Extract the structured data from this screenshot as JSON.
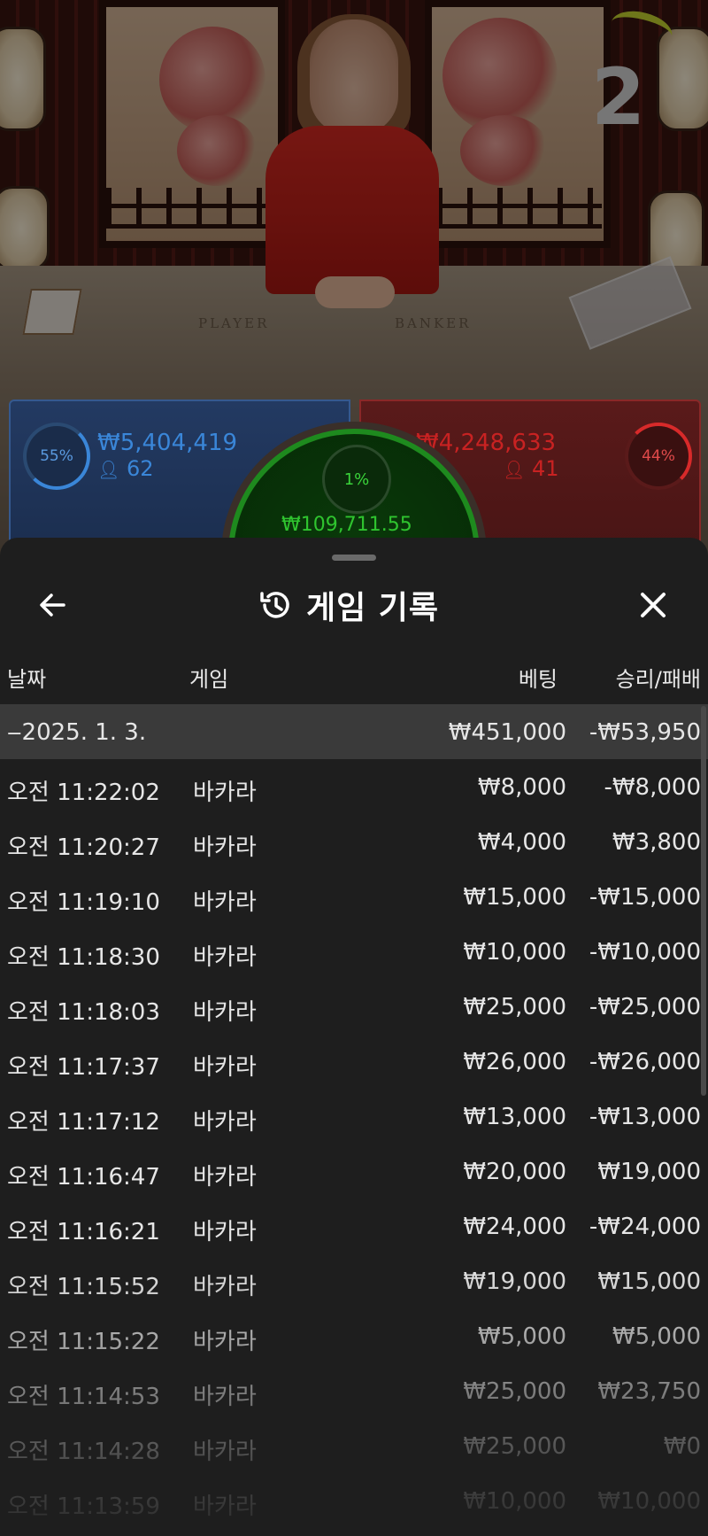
{
  "scene": {
    "round_number": "2",
    "table_player_label": "PLAYER",
    "table_banker_label": "BANKER"
  },
  "bets": {
    "player": {
      "percent": "55%",
      "amount": "₩5,404,419",
      "count": "62",
      "color": "#3a86d8"
    },
    "banker": {
      "percent": "44%",
      "amount": "₩4,248,633",
      "count": "41",
      "color": "#d82a2a"
    },
    "tie": {
      "percent": "1%",
      "amount": "₩109,711.55",
      "color": "#2fc42f"
    }
  },
  "sheet": {
    "title": "게임 기록",
    "history_icon": "history-icon",
    "back_icon": "arrow-left-icon",
    "close_icon": "close-icon",
    "columns": {
      "date": "날짜",
      "game": "게임",
      "bet": "베팅",
      "result": "승리/패배"
    },
    "day_row": {
      "date": "‒2025. 1. 3.",
      "bet": "₩451,000",
      "result": "-₩53,950"
    },
    "rows": [
      {
        "time": "오전 11:22:02",
        "game": "바카라",
        "bet": "₩8,000",
        "result": "-₩8,000"
      },
      {
        "time": "오전 11:20:27",
        "game": "바카라",
        "bet": "₩4,000",
        "result": "₩3,800"
      },
      {
        "time": "오전 11:19:10",
        "game": "바카라",
        "bet": "₩15,000",
        "result": "-₩15,000"
      },
      {
        "time": "오전 11:18:30",
        "game": "바카라",
        "bet": "₩10,000",
        "result": "-₩10,000"
      },
      {
        "time": "오전 11:18:03",
        "game": "바카라",
        "bet": "₩25,000",
        "result": "-₩25,000"
      },
      {
        "time": "오전 11:17:37",
        "game": "바카라",
        "bet": "₩26,000",
        "result": "-₩26,000"
      },
      {
        "time": "오전 11:17:12",
        "game": "바카라",
        "bet": "₩13,000",
        "result": "-₩13,000"
      },
      {
        "time": "오전 11:16:47",
        "game": "바카라",
        "bet": "₩20,000",
        "result": "₩19,000"
      },
      {
        "time": "오전 11:16:21",
        "game": "바카라",
        "bet": "₩24,000",
        "result": "-₩24,000"
      },
      {
        "time": "오전 11:15:52",
        "game": "바카라",
        "bet": "₩19,000",
        "result": "₩15,000"
      },
      {
        "time": "오전 11:15:22",
        "game": "바카라",
        "bet": "₩5,000",
        "result": "₩5,000"
      },
      {
        "time": "오전 11:14:53",
        "game": "바카라",
        "bet": "₩25,000",
        "result": "₩23,750"
      },
      {
        "time": "오전 11:14:28",
        "game": "바카라",
        "bet": "₩25,000",
        "result": "₩0"
      },
      {
        "time": "오전 11:13:59",
        "game": "바카라",
        "bet": "₩10,000",
        "result": "₩10,000"
      }
    ]
  }
}
